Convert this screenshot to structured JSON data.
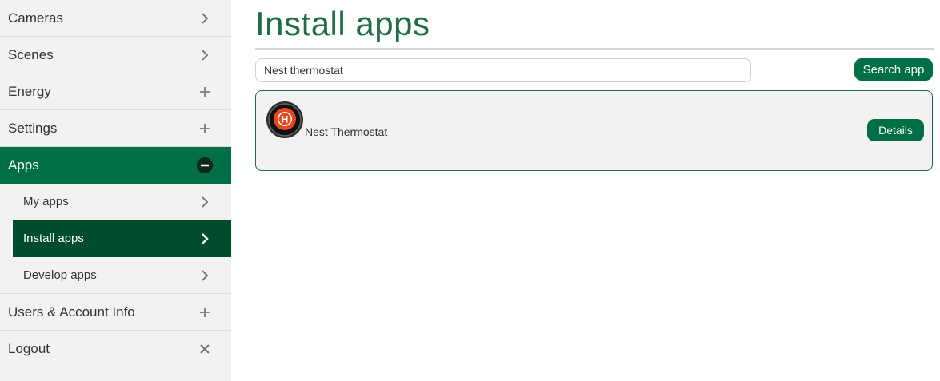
{
  "sidebar": {
    "items": [
      {
        "label": "Cameras",
        "icon": "chevron-right-icon"
      },
      {
        "label": "Scenes",
        "icon": "chevron-right-icon"
      },
      {
        "label": "Energy",
        "icon": "plus-icon"
      },
      {
        "label": "Settings",
        "icon": "plus-icon"
      },
      {
        "label": "Apps",
        "icon": "minus-circle-icon"
      },
      {
        "label": "My apps",
        "icon": "chevron-right-icon"
      },
      {
        "label": "Install apps",
        "icon": "chevron-right-icon"
      },
      {
        "label": "Develop apps",
        "icon": "chevron-right-icon"
      },
      {
        "label": "Users & Account Info",
        "icon": "plus-icon"
      },
      {
        "label": "Logout",
        "icon": "close-icon"
      }
    ]
  },
  "main": {
    "title": "Install apps",
    "search": {
      "value": "Nest thermostat",
      "button_label": "Search app"
    },
    "results": [
      {
        "name": "Nest Thermostat",
        "icon_letter": "H",
        "button_label": "Details"
      }
    ]
  },
  "colors": {
    "brand_green": "#006f45",
    "selected_green": "#004d2e",
    "title_green": "#1e6e45",
    "sidebar_bg": "#f2f2f2",
    "thermostat_orange": "#e8491b"
  }
}
